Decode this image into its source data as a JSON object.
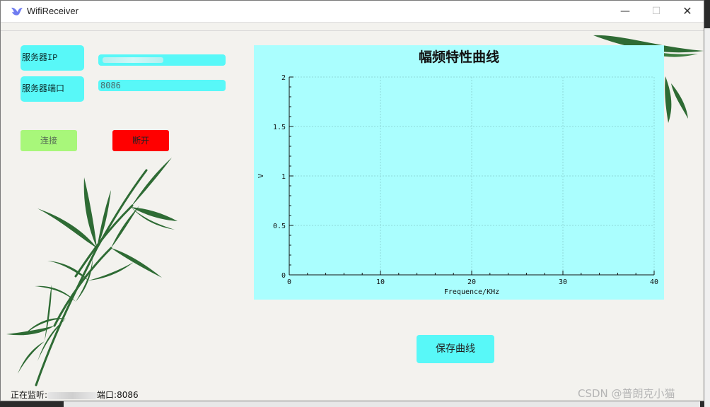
{
  "window": {
    "title": "WifiReceiver",
    "minimize_glyph": "—",
    "maximize_glyph": "☐",
    "close_glyph": "✕"
  },
  "form": {
    "ip_label": "服务器IP",
    "port_label": "服务器端口",
    "port_value": "8086"
  },
  "buttons": {
    "connect": "连接",
    "disconnect": "断开",
    "save": "保存曲线"
  },
  "chart_data": {
    "type": "line",
    "title": "幅频特性曲线",
    "xlabel": "Frequence/KHz",
    "ylabel": "V",
    "xlim": [
      0,
      40
    ],
    "ylim": [
      0,
      2
    ],
    "x_ticks": [
      "0",
      "10",
      "20",
      "30",
      "40"
    ],
    "y_ticks": [
      "0",
      "0.5",
      "1",
      "1.5",
      "2"
    ],
    "grid": true,
    "series": []
  },
  "status": {
    "listening_label": "正在监听:",
    "port_label": "端口:",
    "port_value": "8086"
  },
  "watermark": "CSDN @普朗克小猫",
  "colors": {
    "cyan": "#58f8f8",
    "chart_bg": "#aafefe",
    "connect_green": "#a8f77a",
    "disconnect_red": "#ff0000",
    "bamboo": "#2e6b34"
  }
}
